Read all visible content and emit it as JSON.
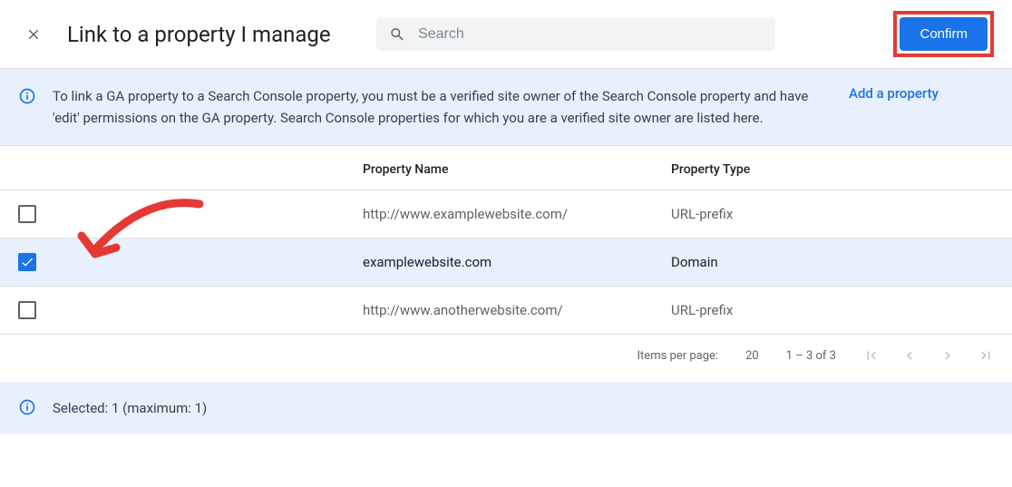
{
  "header": {
    "title": "Link to a property I manage",
    "search_placeholder": "Search",
    "confirm_label": "Confirm"
  },
  "info": {
    "text": "To link a GA property to a Search Console property, you must be a verified site owner of the Search Console property and have 'edit' permissions on the GA property. Search Console properties for which you are a verified site owner are listed here.",
    "add_link": "Add a property"
  },
  "table": {
    "columns": {
      "name": "Property Name",
      "type": "Property Type"
    },
    "rows": [
      {
        "checked": false,
        "name": "http://www.examplewebsite.com/",
        "type": "URL-prefix"
      },
      {
        "checked": true,
        "name": "examplewebsite.com",
        "type": "Domain"
      },
      {
        "checked": false,
        "name": "http://www.anotherwebsite.com/",
        "type": "URL-prefix"
      }
    ]
  },
  "pagination": {
    "items_label": "Items per page:",
    "items_count": "20",
    "range": "1 – 3 of 3"
  },
  "footer": {
    "selected_text": "Selected: 1 (maximum: 1)"
  }
}
